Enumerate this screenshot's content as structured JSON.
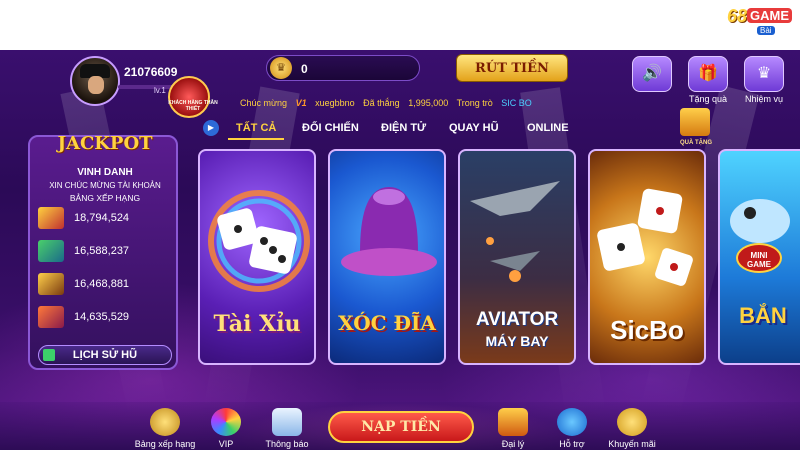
{
  "header": {
    "player_id": "21076609",
    "level": "lv.1",
    "badge_text": "KHÁCH HÀNG THÂN THIẾT",
    "coins": "0",
    "withdraw_label": "RÚT TIỀN",
    "sound_icon": "speaker-icon",
    "gift_label": "Tặng quà",
    "mission_label": "Nhiệm vụ",
    "logo": {
      "number": "68",
      "game": "GAME",
      "bai": "Bài"
    }
  },
  "ticker": {
    "prefix": "Chúc mừng",
    "vip": "V1",
    "username": "xuegbbno",
    "won_text": "Đã thắng",
    "amount": "1,995,000",
    "in_text": "Trong trò",
    "game": "SIC BO"
  },
  "tabs": [
    "TẤT CẢ",
    "ĐỐI CHIẾN",
    "ĐIỆN TỬ",
    "QUAY HŨ",
    "ONLINE"
  ],
  "gift_corner_label": "QUÀ TẶNG",
  "jackpot": {
    "title": "JACKPOT",
    "subtitle": "VINH DANH",
    "congrats": "XIN CHÚC MỪNG TÀI KHOẢN",
    "rank": "BẢNG XẾP HẠNG",
    "rows": [
      {
        "value": "18,794,524"
      },
      {
        "value": "16,588,237"
      },
      {
        "value": "16,468,881"
      },
      {
        "value": "14,635,529"
      }
    ],
    "history_label": "LỊCH SỬ HŨ"
  },
  "games": [
    {
      "title": "Tài Xỉu"
    },
    {
      "title": "XÓC ĐĨA"
    },
    {
      "title": "AVIATOR",
      "subtitle": "MÁY BAY"
    },
    {
      "title": "SicBo"
    },
    {
      "title": "BẮN",
      "badge": "MINI GAME"
    }
  ],
  "bottom_nav": {
    "leaderboard": "Bảng xếp hạng",
    "vip": "VIP",
    "notice": "Thông báo",
    "deposit": "NẠP TIỀN",
    "agent": "Đại lý",
    "support": "Hỗ trợ",
    "promo": "Khuyến mãi"
  },
  "colors": {
    "accent": "#ffd23f",
    "background": "#3a0f6e",
    "deposit": "#c8181a"
  }
}
